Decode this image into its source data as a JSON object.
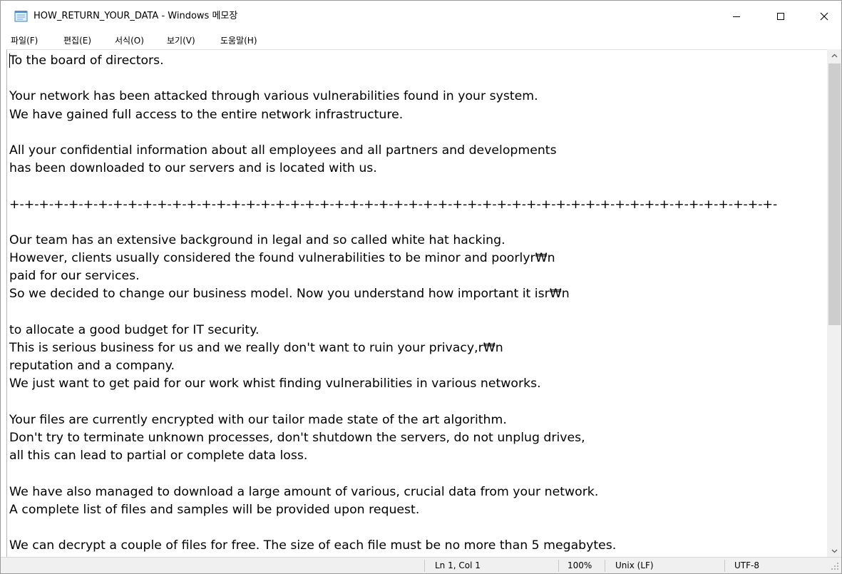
{
  "window": {
    "title": "HOW_RETURN_YOUR_DATA - Windows 메모장",
    "app_icon": "notepad-icon",
    "controls": {
      "minimize": "minimize-icon",
      "maximize": "maximize-icon",
      "close": "close-icon"
    }
  },
  "menu": {
    "items": [
      {
        "label": "파일(F)"
      },
      {
        "label": "편집(E)"
      },
      {
        "label": "서식(O)"
      },
      {
        "label": "보기(V)"
      },
      {
        "label": "도움말(H)"
      }
    ]
  },
  "editor": {
    "lines": [
      "To the board of directors.",
      "",
      "Your network has been attacked through various vulnerabilities found in your system.",
      "We have gained full access to the entire network infrastructure.",
      "",
      "All your confidential information about all employees and all partners and developments",
      "has been downloaded to our servers and is located with us.",
      "",
      "+-+-+-+-+-+-+-+-+-+-+-+-+-+-+-+-+-+-+-+-+-+-+-+-+-+-+-+-+-+-+-+-+-+-+-+-+-+-+-+-+-+-+-+-+-+-+-+-+-+-+-+-",
      "",
      "Our team has an extensive background in legal and so called white hat hacking.",
      "However, clients usually considered the found vulnerabilities to be minor and poorlyr₩n",
      "paid for our services.",
      "So we decided to change our business model. Now you understand how important it isr₩n",
      "",
      "to allocate a good budget for IT security.",
      "This is serious business for us and we really don't want to ruin your privacy,r₩n",
      "reputation and a company.",
      "We just want to get paid for our work whist finding vulnerabilities in various networks.",
      "",
      "Your files are currently encrypted with our tailor made state of the art algorithm.",
      "Don't try to terminate unknown processes, don't shutdown the servers, do not unplug drives,",
      "all this can lead to partial or complete data loss.",
      "",
      "We have also managed to download a large amount of various, crucial data from your network.",
      "A complete list of files and samples will be provided upon request.",
      "",
      "We can decrypt a couple of files for free. The size of each file must be no more than 5 megabytes."
    ]
  },
  "scrollbar": {
    "up_icon": "scroll-up-arrow-icon",
    "down_icon": "scroll-down-arrow-icon"
  },
  "status": {
    "position": "Ln 1, Col 1",
    "zoom": "100%",
    "line_ending": "Unix (LF)",
    "encoding": "UTF-8"
  }
}
